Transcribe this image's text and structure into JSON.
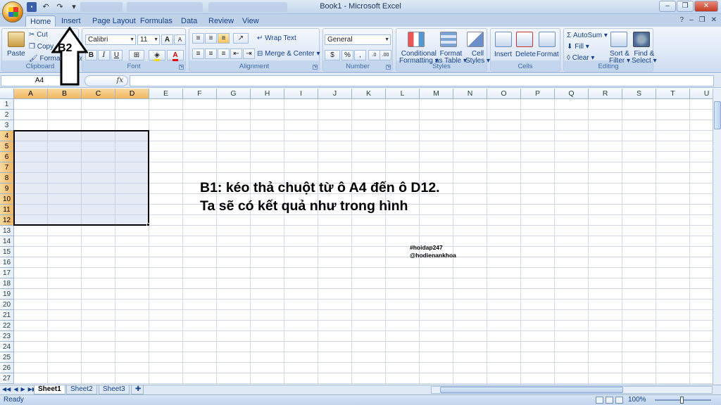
{
  "window": {
    "title": "Book1 - Microsoft Excel"
  },
  "tabs": [
    "Home",
    "Insert",
    "Page Layout",
    "Formulas",
    "Data",
    "Review",
    "View"
  ],
  "clipboard": {
    "paste": "Paste",
    "cut": "Cut",
    "copy": "Copy",
    "format_painter": "Format Painter",
    "label": "Clipboard"
  },
  "font": {
    "name": "Calibri",
    "size": "11",
    "label": "Font",
    "bold": "B",
    "italic": "I",
    "underline": "U",
    "grow": "A",
    "shrink": "A",
    "color_letter": "A"
  },
  "alignment": {
    "wrap_text": "Wrap Text",
    "merge_center": "Merge & Center",
    "label": "Alignment"
  },
  "number": {
    "format": "General",
    "currency": "$",
    "percent": "%",
    "comma": ",",
    "inc_dec": ".0",
    "dec_dec": ".00",
    "label": "Number"
  },
  "styles": {
    "conditional": "Conditional",
    "conditional2": "Formatting",
    "format_as": "Format",
    "format_as2": "as Table",
    "cell": "Cell",
    "cell2": "Styles",
    "label": "Styles"
  },
  "cells": {
    "insert": "Insert",
    "delete": "Delete",
    "format": "Format",
    "label": "Cells"
  },
  "editing": {
    "autosum": "AutoSum",
    "fill": "Fill",
    "clear": "Clear",
    "sort": "Sort &",
    "sort2": "Filter",
    "find": "Find &",
    "find2": "Select",
    "label": "Editing"
  },
  "formula_bar": {
    "name_box": "A4",
    "fx": "fx"
  },
  "columns": [
    "A",
    "B",
    "C",
    "D",
    "E",
    "F",
    "G",
    "H",
    "I",
    "J",
    "K",
    "L",
    "M",
    "N",
    "O",
    "P",
    "Q",
    "R",
    "S",
    "T",
    "U"
  ],
  "rows": [
    "1",
    "2",
    "3",
    "4",
    "5",
    "6",
    "7",
    "8",
    "9",
    "10",
    "11",
    "12",
    "13",
    "14",
    "15",
    "16",
    "17",
    "18",
    "19",
    "20",
    "21",
    "22",
    "23",
    "24",
    "25",
    "26",
    "27"
  ],
  "annotation": {
    "arrow_label": "B2",
    "line1": "B1: kéo thả chuột từ ô A4 đến ô D12.",
    "line2": "Ta sẽ có kết quả như trong hình",
    "tag1": "#hoidap247",
    "tag2": "@hodienankhoa"
  },
  "sheets": [
    "Sheet1",
    "Sheet2",
    "Sheet3"
  ],
  "status": {
    "ready": "Ready",
    "zoom": "100%"
  }
}
